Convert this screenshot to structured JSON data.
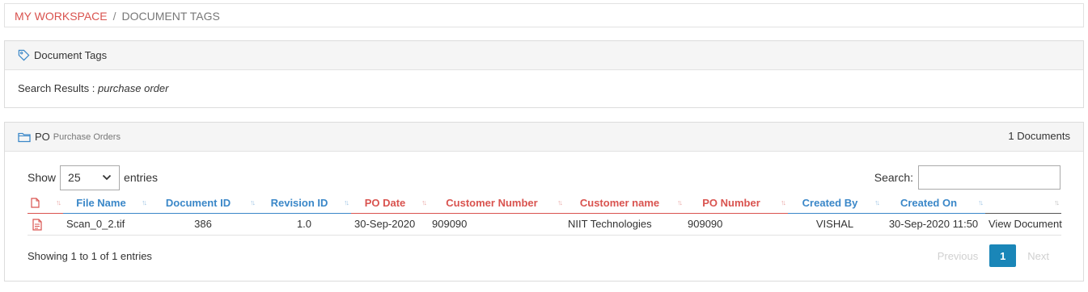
{
  "breadcrumb": {
    "home": "MY WORKSPACE",
    "separator": "/",
    "current": "DOCUMENT TAGS"
  },
  "tags_panel": {
    "title": "Document Tags",
    "icon": "tag-icon",
    "search_label": "Search Results :",
    "search_term": "purchase order"
  },
  "po_panel": {
    "icon": "folder-icon",
    "code": "PO",
    "subtitle": "Purchase Orders",
    "count": "1 Documents"
  },
  "table_controls": {
    "show_label": "Show",
    "entries_value": "25",
    "entries_label": "entries",
    "search_label": "Search:"
  },
  "table": {
    "headers": {
      "file_name": "File Name",
      "document_id": "Document ID",
      "revision_id": "Revision ID",
      "po_date": "PO Date",
      "customer_number": "Customer Number",
      "customer_name": "Customer name",
      "po_number": "PO Number",
      "created_by": "Created By",
      "created_on": "Created On"
    },
    "rows": [
      {
        "file_name": "Scan_0_2.tif",
        "document_id": "386",
        "revision_id": "1.0",
        "po_date": "30-Sep-2020",
        "customer_number": "909090",
        "customer_name": "NIIT Technologies",
        "po_number": "909090",
        "created_by": "VISHAL",
        "created_on": "30-Sep-2020 11:50",
        "action": "View Document"
      }
    ]
  },
  "footer": {
    "info": "Showing 1 to 1 of 1 entries",
    "previous": "Previous",
    "current_page": "1",
    "next": "Next"
  },
  "colors": {
    "accent_red": "#d9534f",
    "accent_blue": "#3a87c8",
    "pager_active": "#1a86b8"
  }
}
